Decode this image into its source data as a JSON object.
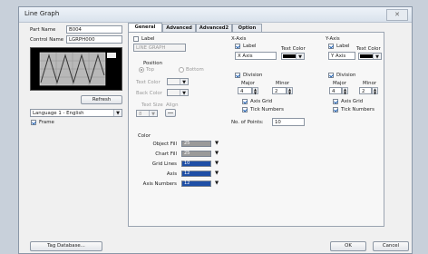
{
  "window": {
    "title": "Line Graph",
    "close": "✕"
  },
  "left": {
    "part_name_label": "Part Name",
    "part_name_value": "B004",
    "control_name_label": "Control Name",
    "control_name_value": "LGRPH000",
    "refresh_label": "Refresh",
    "language_value": "Language 1 - English",
    "frame_label": "Frame",
    "frame_checked": true
  },
  "tabs": [
    "General",
    "Advanced",
    "Advanced2",
    "Option"
  ],
  "general": {
    "label_text": "Label",
    "label_value": "LINE GRAPH",
    "position_title": "Position",
    "pos_top": "Top",
    "pos_bottom": "Bottom",
    "text_color_label": "Text Color",
    "back_color_label": "Back Color",
    "text_size_label": "Text Size",
    "text_size_value": "8",
    "align_label": "Align"
  },
  "color": {
    "title": "Color",
    "rows": [
      {
        "label": "Object Fill",
        "value": "25",
        "color": "#9a9a9a"
      },
      {
        "label": "Chart Fill",
        "value": "25",
        "color": "#9a9a9a"
      },
      {
        "label": "Grid Lines",
        "value": "10",
        "color": "#1f4fa6"
      },
      {
        "label": "Axis",
        "value": "12",
        "color": "#1f4fa6"
      },
      {
        "label": "Axis Numbers",
        "value": "12",
        "color": "#1f4fa6"
      }
    ]
  },
  "xaxis": {
    "title": "X-Axis",
    "label_text": "Label",
    "label_value": "X Axis",
    "text_color_label": "Text Color",
    "division_label": "Division",
    "major_label": "Major",
    "major_value": "4",
    "minor_label": "Minor",
    "minor_value": "2",
    "axis_grid_label": "Axis Grid",
    "tick_numbers_label": "Tick Numbers",
    "points_label": "No. of Points:",
    "points_value": "10"
  },
  "yaxis": {
    "title": "Y-Axis",
    "label_text": "Label",
    "label_value": "Y Axis",
    "text_color_label": "Text Color",
    "division_label": "Division",
    "major_label": "Major",
    "major_value": "4",
    "minor_label": "Minor",
    "minor_value": "2",
    "axis_grid_label": "Axis Grid",
    "tick_numbers_label": "Tick Numbers"
  },
  "footer": {
    "tag_db": "Tag Database...",
    "ok": "OK",
    "cancel": "Cancel"
  }
}
